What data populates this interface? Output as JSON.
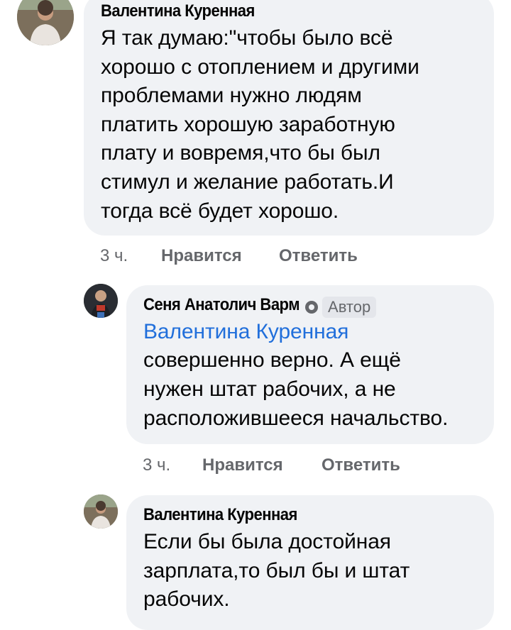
{
  "comments": [
    {
      "author": "Валентина Куренная",
      "lines": [
        "Я так думаю:\"чтобы было всё",
        "хорошо с отоплением и другими",
        "проблемами нужно людям",
        "платить хорошую заработную",
        "плату и вовремя,что бы был",
        "стимул и желание работать.И",
        "тогда всё будет хорошо."
      ],
      "time": "3 ч.",
      "like_label": "Нравится",
      "reply_label": "Ответить"
    },
    {
      "author": "Сеня Анатолич Варм",
      "badge": "Автор",
      "mention": "Валентина Куренная",
      "lines": [
        "совершенно верно. А ещё",
        "нужен штат рабочих, а не",
        "расположившееся начальство."
      ],
      "time": "3 ч.",
      "like_label": "Нравится",
      "reply_label": "Ответить"
    },
    {
      "author": "Валентина Куренная",
      "lines": [
        "Если бы была достойная",
        "зарплата,то был бы и штат",
        "рабочих."
      ]
    }
  ],
  "colors": {
    "bubble": "#f0f2f5",
    "mention": "#216fdb",
    "meta": "#65676b"
  }
}
